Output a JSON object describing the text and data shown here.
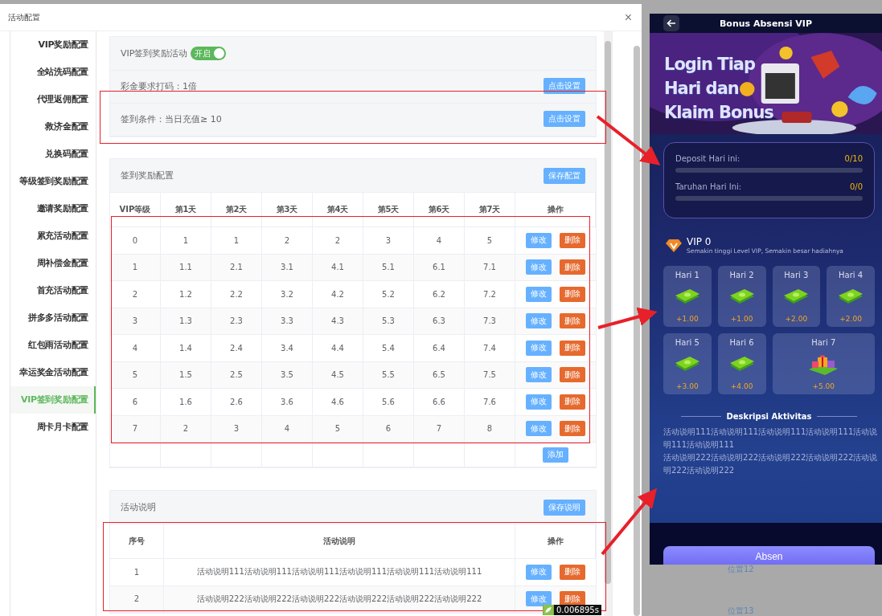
{
  "dialog": {
    "title": "活动配置",
    "close": "×"
  },
  "sidebar": {
    "items": [
      {
        "label": "VIP奖励配置",
        "selected": false
      },
      {
        "label": "全站洗码配置",
        "selected": false
      },
      {
        "label": "代理返佣配置",
        "selected": false
      },
      {
        "label": "救济金配置",
        "selected": false
      },
      {
        "label": "兑换码配置",
        "selected": false
      },
      {
        "label": "等级签到奖励配置",
        "selected": false
      },
      {
        "label": "邀请奖励配置",
        "selected": false
      },
      {
        "label": "累充活动配置",
        "selected": false
      },
      {
        "label": "周补偿金配置",
        "selected": false
      },
      {
        "label": "首充活动配置",
        "selected": false
      },
      {
        "label": "拼多多活动配置",
        "selected": false
      },
      {
        "label": "红包雨活动配置",
        "selected": false
      },
      {
        "label": "幸运奖金活动配置",
        "selected": false
      },
      {
        "label": "VIP签到奖励配置",
        "selected": true
      },
      {
        "label": "周卡月卡配置",
        "selected": false
      }
    ]
  },
  "activity": {
    "title": "VIP签到奖励活动",
    "toggle": {
      "label": "开启",
      "on": true
    },
    "settings": [
      {
        "label": "彩金要求打码：1倍",
        "button": "点击设置"
      },
      {
        "label": "签到条件：当日充值≥ 10",
        "button": "点击设置"
      }
    ]
  },
  "reward_table": {
    "title": "签到奖励配置",
    "save": "保存配置",
    "columns": [
      "VIP等级",
      "第1天",
      "第2天",
      "第3天",
      "第4天",
      "第5天",
      "第6天",
      "第7天",
      "操作"
    ],
    "rows": [
      {
        "cells": [
          "0",
          "1",
          "1",
          "2",
          "2",
          "3",
          "4",
          "5"
        ],
        "edit": "修改",
        "delete": "删除"
      },
      {
        "cells": [
          "1",
          "1.1",
          "2.1",
          "3.1",
          "4.1",
          "5.1",
          "6.1",
          "7.1"
        ],
        "edit": "修改",
        "delete": "删除"
      },
      {
        "cells": [
          "2",
          "1.2",
          "2.2",
          "3.2",
          "4.2",
          "5.2",
          "6.2",
          "7.2"
        ],
        "edit": "修改",
        "delete": "删除"
      },
      {
        "cells": [
          "3",
          "1.3",
          "2.3",
          "3.3",
          "4.3",
          "5.3",
          "6.3",
          "7.3"
        ],
        "edit": "修改",
        "delete": "删除"
      },
      {
        "cells": [
          "4",
          "1.4",
          "2.4",
          "3.4",
          "4.4",
          "5.4",
          "6.4",
          "7.4"
        ],
        "edit": "修改",
        "delete": "删除"
      },
      {
        "cells": [
          "5",
          "1.5",
          "2.5",
          "3.5",
          "4.5",
          "5.5",
          "6.5",
          "7.5"
        ],
        "edit": "修改",
        "delete": "删除"
      },
      {
        "cells": [
          "6",
          "1.6",
          "2.6",
          "3.6",
          "4.6",
          "5.6",
          "6.6",
          "7.6"
        ],
        "edit": "修改",
        "delete": "删除"
      },
      {
        "cells": [
          "7",
          "2",
          "3",
          "4",
          "5",
          "6",
          "7",
          "8"
        ],
        "edit": "修改",
        "delete": "删除"
      }
    ],
    "add": "添加"
  },
  "description_table": {
    "title": "活动说明",
    "save": "保存说明",
    "columns": [
      "序号",
      "活动说明",
      "操作"
    ],
    "rows": [
      {
        "cells": [
          "1",
          "活动说明111活动说明111活动说明111活动说明111活动说明111活动说明111"
        ],
        "edit": "修改",
        "delete": "删除"
      },
      {
        "cells": [
          "2",
          "活动说明222活动说明222活动说明222活动说明222活动说明222活动说明222"
        ],
        "edit": "修改",
        "delete": "删除"
      }
    ]
  },
  "phone": {
    "title": "Bonus Absensi VIP",
    "banner_lines": [
      "Login Tiap",
      "Hari dan",
      "Klaim Bonus"
    ],
    "progress": [
      {
        "label": "Deposit Hari ini:",
        "reading": "0/10",
        "level": 0
      },
      {
        "label": "Taruhan Hari Ini:",
        "reading": "0/0",
        "level": 0
      }
    ],
    "vip": {
      "title": "VIP 0",
      "subtitle": "Semakin tinggi Level VIP, Semakin besar hadiahnya"
    },
    "days": [
      {
        "label": "Hari 1",
        "reward": "+1.00",
        "kind": "cash"
      },
      {
        "label": "Hari 2",
        "reward": "+1.00",
        "kind": "cash"
      },
      {
        "label": "Hari 3",
        "reward": "+2.00",
        "kind": "cash"
      },
      {
        "label": "Hari 4",
        "reward": "+2.00",
        "kind": "cash"
      },
      {
        "label": "Hari 5",
        "reward": "+3.00",
        "kind": "cash"
      },
      {
        "label": "Hari 6",
        "reward": "+4.00",
        "kind": "cash"
      },
      {
        "label": "Hari 7",
        "reward": "+5.00",
        "kind": "gift"
      }
    ],
    "description_title": "Deskripsi Aktivitas",
    "description": [
      "活动说明111活动说明111活动说明111活动说明111活动说明111活动说明111",
      "活动说明222活动说明222活动说明222活动说明222活动说明222活动说明222"
    ],
    "button": "Absen"
  },
  "background_cells": [
    "位置12",
    "位置13"
  ],
  "timing_badge": "0.006895s"
}
